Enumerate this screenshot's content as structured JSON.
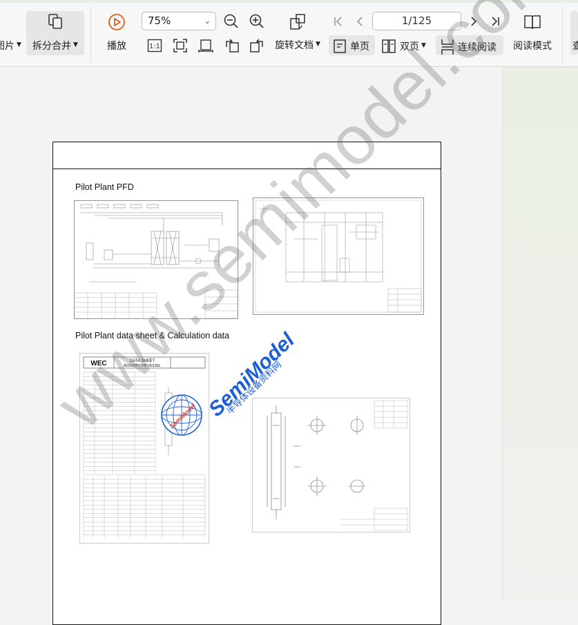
{
  "toolbar": {
    "cut_left_label": "图片",
    "split_merge_label": "拆分合并",
    "play_label": "播放",
    "zoom_value": "75%",
    "page_indicator": "1/125",
    "rotate_doc_label": "旋转文档",
    "single_page_label": "单页",
    "double_page_label": "双页",
    "continuous_label": "连续阅读",
    "read_mode_label": "阅读模式",
    "cut_right_label": "查"
  },
  "document": {
    "section1_title": "Pilot Plant PFD",
    "section2_title": "Pilot Plant data sheet & Calculation data",
    "datasheet_header_left": "WEC",
    "datasheet_header_title": "DATA SHEET",
    "datasheet_header_sub": "ADSORPTION VESSEL"
  },
  "watermark": {
    "url": "www.semimodel.com",
    "logo_text": "SemiModel",
    "logo_sub": "半导体设备资料网",
    "seal_text": "SemiModel"
  },
  "colors": {
    "accent_blue": "#1d5fd6",
    "toolbar_bg": "#f7f7f7",
    "pill_bg": "#e6e6e6",
    "right_pane": "#e9efe4"
  }
}
